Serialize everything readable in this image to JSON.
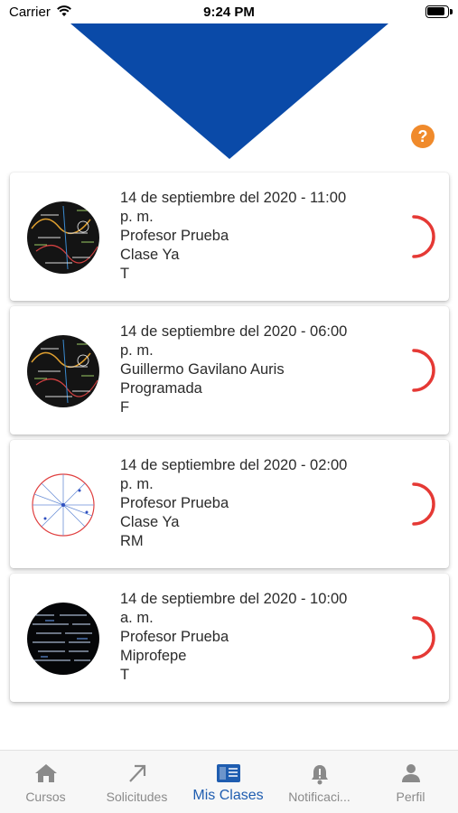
{
  "status_bar": {
    "carrier": "Carrier",
    "time": "9:24 PM"
  },
  "colors": {
    "brand_blue": "#0a4aa8",
    "help_orange": "#f08a2b",
    "spinner_red": "#e53935",
    "active_tab": "#1f5db0"
  },
  "header": {
    "help_icon": "question-circle-icon",
    "help_label": "?"
  },
  "classes": [
    {
      "date": "14 de septiembre del 2020 - 11:00",
      "period": "p. m.",
      "teacher": "Profesor Prueba",
      "type": "Clase Ya",
      "code": "T",
      "avatar": "math-chalkboard-image"
    },
    {
      "date": "14 de septiembre del 2020 - 06:00",
      "period": "p. m.",
      "teacher": "Guillermo Gavilano Auris",
      "type": "Programada",
      "code": "F",
      "avatar": "math-chalkboard-image"
    },
    {
      "date": "14 de septiembre del 2020 - 02:00",
      "period": "p. m.",
      "teacher": "Profesor Prueba",
      "type": "Clase Ya",
      "code": "RM",
      "avatar": "circle-geometry-image"
    },
    {
      "date": "14 de septiembre del 2020 - 10:00",
      "period": "a. m.",
      "teacher": "Profesor Prueba",
      "type": "Miprofepe",
      "code": "T",
      "avatar": "formula-blackboard-image"
    }
  ],
  "tabs": [
    {
      "label": "Cursos",
      "icon": "home-icon",
      "active": false
    },
    {
      "label": "Solicitudes",
      "icon": "arrow-up-right-icon",
      "active": false
    },
    {
      "label": "Mis Clases",
      "icon": "book-icon",
      "active": true
    },
    {
      "label": "Notificaci...",
      "icon": "bell-icon",
      "active": false
    },
    {
      "label": "Perfil",
      "icon": "person-icon",
      "active": false
    }
  ]
}
